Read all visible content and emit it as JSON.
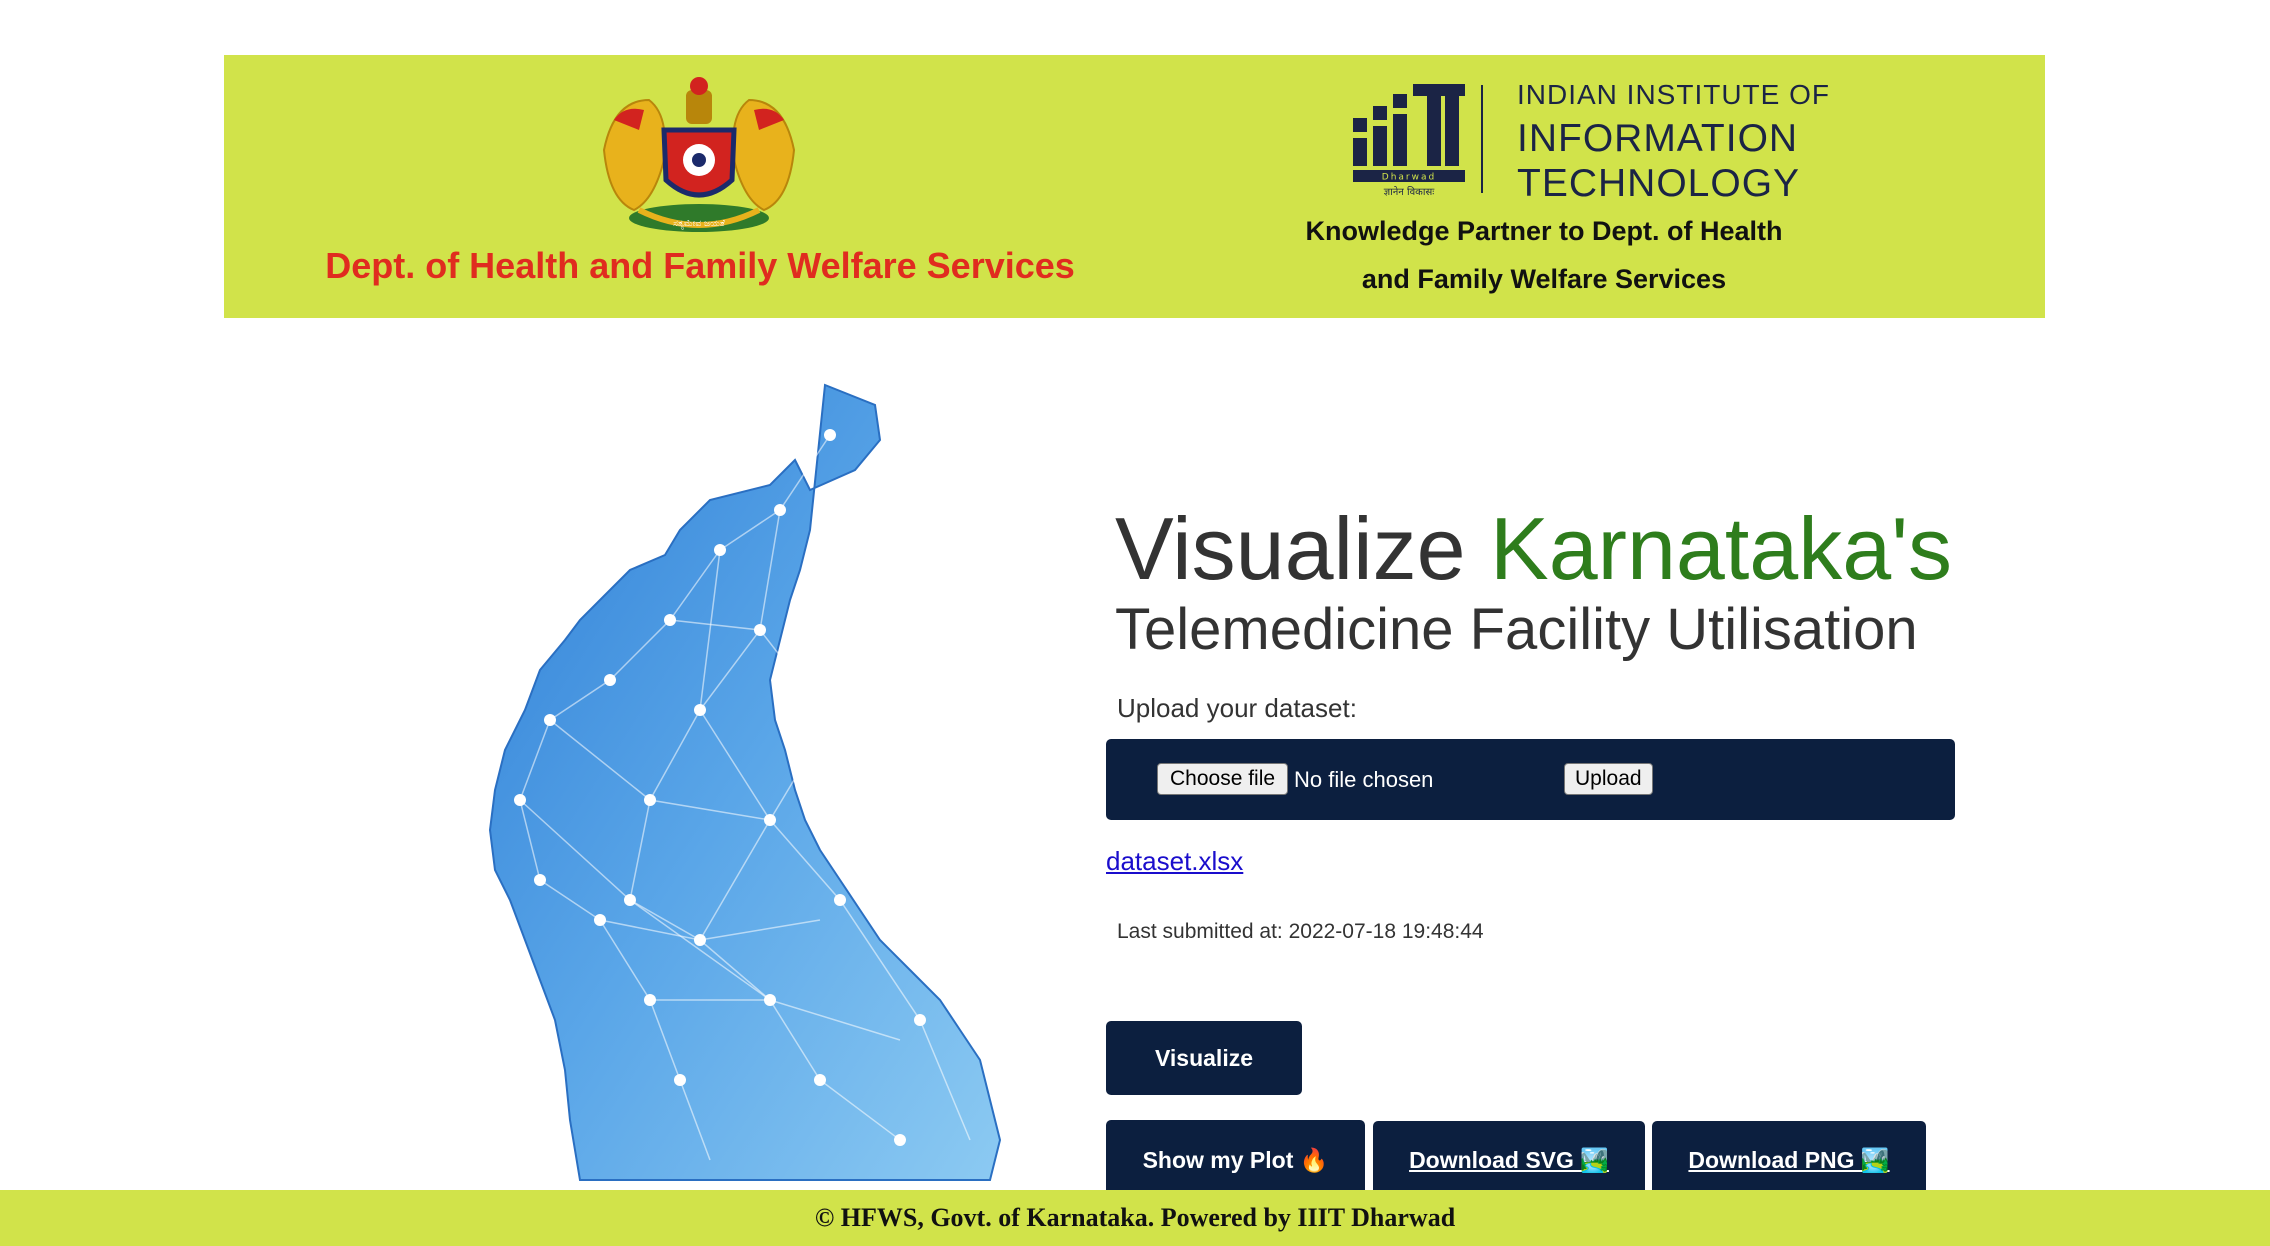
{
  "banner": {
    "dept_title": "Dept. of Health and Family Welfare Services",
    "emblem_motto": "ಸತ್ಯಮೇವ ಜಯತೆ",
    "iiit": {
      "line1": "INDIAN INSTITUTE OF",
      "line2": "INFORMATION",
      "line3": "TECHNOLOGY",
      "logo_sub": "Dharwad",
      "logo_motto": "ज्ञानेन विकासः"
    },
    "partner_line1": "Knowledge Partner to Dept. of Health",
    "partner_line2": "and Family Welfare Services",
    "color": "#d1e34a"
  },
  "hero": {
    "line1_prefix": "Visualize ",
    "line1_highlight": "Karnataka's",
    "line2": "Telemedicine Facility Utilisation",
    "highlight_color": "#2e7d1c"
  },
  "upload": {
    "label": "Upload your dataset:",
    "choose_file_label": "Choose file",
    "no_file_text": "No file chosen",
    "upload_label": "Upload",
    "bar_color": "#0c1f3f"
  },
  "dataset_link": "dataset.xlsx",
  "last_submitted": "Last submitted at: 2022-07-18 19:48:44",
  "actions": {
    "visualize": "Visualize",
    "show_plot": "Show my Plot 🔥",
    "download_svg": "Download SVG 🏞️",
    "download_png": "Download PNG 🏞️"
  },
  "map_icon": "karnataka-map-image",
  "footer": "© HFWS, Govt. of Karnataka. Powered by IIIT Dharwad"
}
